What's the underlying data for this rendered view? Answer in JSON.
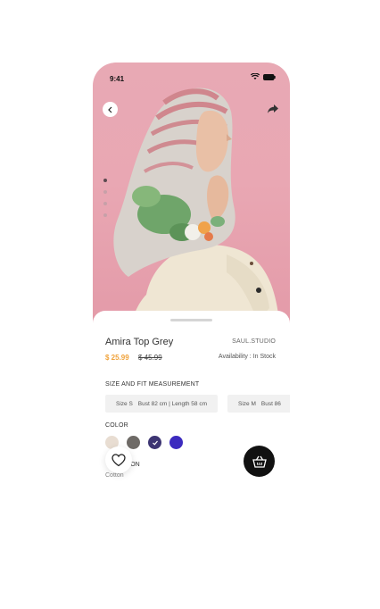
{
  "status": {
    "time": "9:41"
  },
  "product": {
    "title": "Amira Top Grey",
    "brand": "SAUL.STUDIO",
    "price": "$ 25.99",
    "old_price": "$ 45.99",
    "availability": "Availability : In Stock"
  },
  "gallery": {
    "dot_count": 4,
    "active_index": 0
  },
  "size_section": {
    "label": "SIZE AND FIT MEASUREMENT",
    "options": [
      {
        "size": "Size S",
        "measure": "Bust 82 cm | Length 58 cm"
      },
      {
        "size": "Size M",
        "measure": "Bust 86"
      }
    ]
  },
  "color_section": {
    "label": "COLOR",
    "swatches": [
      "#e8ddd2",
      "#6e6a66",
      "#3d3573",
      "#3c2bbf"
    ],
    "selected_index": 2
  },
  "composition": {
    "label": "TION",
    "value": "Cotton"
  },
  "icons": {
    "back": "chevron-left-icon",
    "share": "share-icon",
    "favorite": "heart-icon",
    "cart": "basket-icon"
  }
}
